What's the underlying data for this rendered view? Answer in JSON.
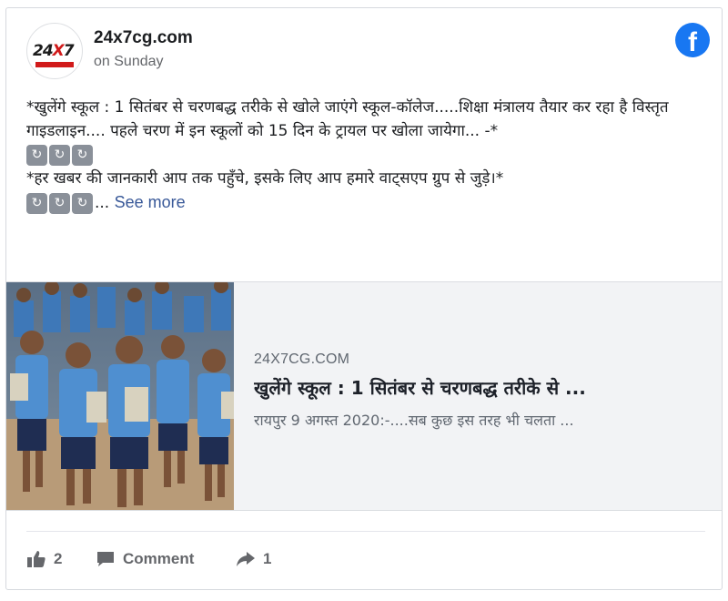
{
  "post": {
    "page_name": "24x7cg.com",
    "time": "on Sunday",
    "avatar_text": "24X7",
    "text_line1": "*खुलेंगे स्कूल : 1 सितंबर से चरणबद्ध तरीके से खोले जाएंगे स्कूल-कॉलेज.....शिक्षा मंत्रालय तैयार कर रहा है विस्तृत गाइडलाइन.... पहले चरण में इन स्कूलों को 15 दिन के ट्रायल पर खोला जायेगा... -*",
    "text_line2": "*हर खबर की जानकारी आप तक पहुँचे, इसके लिए आप हमारे वाट्सएप ग्रुप से जुड़े।*",
    "ellipsis": "...",
    "see_more": "See more",
    "emoji_icon": "clockwise-arrows-icon",
    "emoji_glyph": "↻"
  },
  "link_preview": {
    "domain": "24X7CG.COM",
    "title": "खुलेंगे स्कूल : 1 सितंबर से चरणबद्ध तरीके से ...",
    "description": "रायपुर 9 अगस्त 2020:-....सब कुछ इस तरह भी चलता ..."
  },
  "actions": {
    "like_count": "2",
    "comment_label": "Comment",
    "share_count": "1"
  },
  "colors": {
    "facebook_blue": "#1877f2",
    "link_blue": "#385898",
    "meta_gray": "#65676b"
  }
}
